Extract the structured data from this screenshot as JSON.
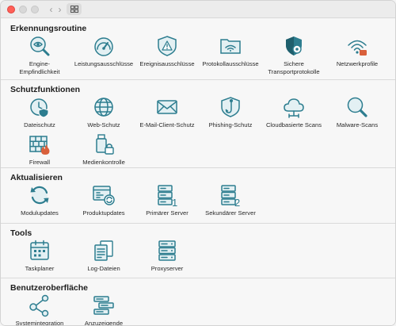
{
  "window": {
    "nav_back": "‹",
    "nav_forward": "›"
  },
  "sections": {
    "erkennung": {
      "title": "Erkennungsroutine",
      "items": [
        "Engine-\nEmpfindlichkeit",
        "Leistungsausschlüsse",
        "Ereignisausschlüsse",
        "Protokollausschlüsse",
        "Sichere\nTransportprotokolle",
        "Netzwerkprofile"
      ]
    },
    "schutz": {
      "title": "Schutzfunktionen",
      "items": [
        "Dateischutz",
        "Web-Schutz",
        "E-Mail-Client-Schutz",
        "Phishing-Schutz",
        "Cloudbasierte Scans",
        "Malware-Scans",
        "Firewall",
        "Medienkontrolle"
      ]
    },
    "aktualisieren": {
      "title": "Aktualisieren",
      "items": [
        "Modulupdates",
        "Produktupdates",
        "Primärer Server",
        "Sekundärer Server"
      ]
    },
    "tools": {
      "title": "Tools",
      "items": [
        "Taskplaner",
        "Log-Dateien",
        "Proxyserver"
      ]
    },
    "ui": {
      "title": "Benutzeroberfläche",
      "items": [
        "Systemintegration",
        "Anzuzeigende\nHinweise"
      ]
    }
  },
  "colors": {
    "icon": "#2d7d8f",
    "alert": "#d9603b"
  }
}
